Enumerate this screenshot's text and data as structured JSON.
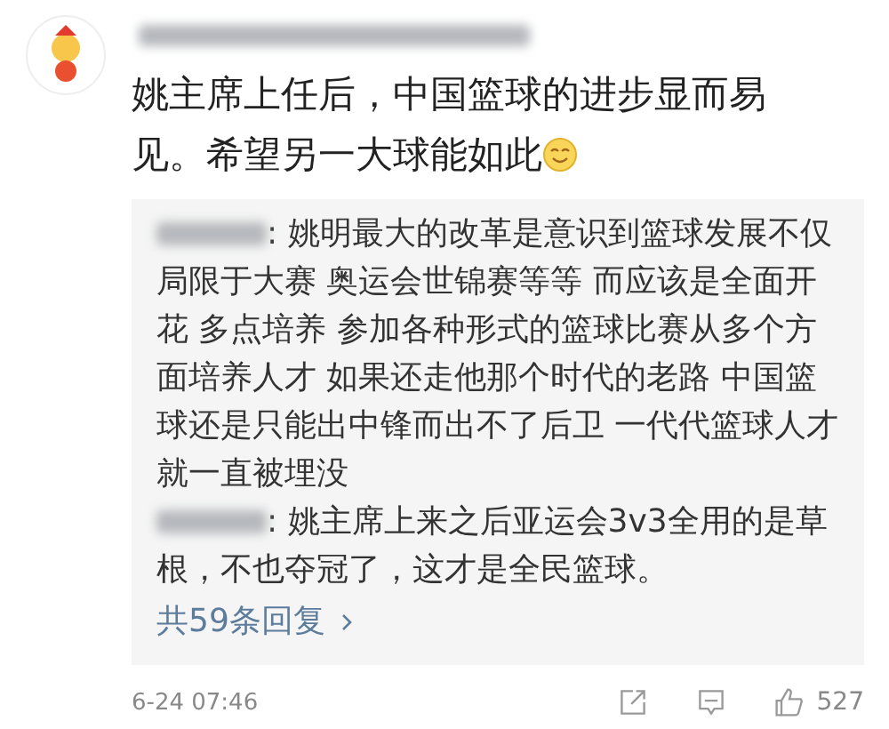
{
  "comment": {
    "text": "姚主席上任后，中国篮球的进步显而易见。希望另一大球能如此",
    "replies": [
      {
        "text": ": 姚明最大的改革是意识到篮球发展不仅局限于大赛 奥运会世锦赛等等 而应该是全面开花 多点培养 参加各种形式的篮球比赛从多个方面培养人才 如果还走他那个时代的老路 中国篮球还是只能出中锋而出不了后卫 一代代篮球人才就一直被埋没"
      },
      {
        "text": ": 姚主席上来之后亚运会3v3全用的是草根，不也夺冠了，这才是全民篮球。"
      }
    ],
    "reply_count": "共59条回复",
    "time": "6-24 07:46",
    "likes": "527"
  }
}
